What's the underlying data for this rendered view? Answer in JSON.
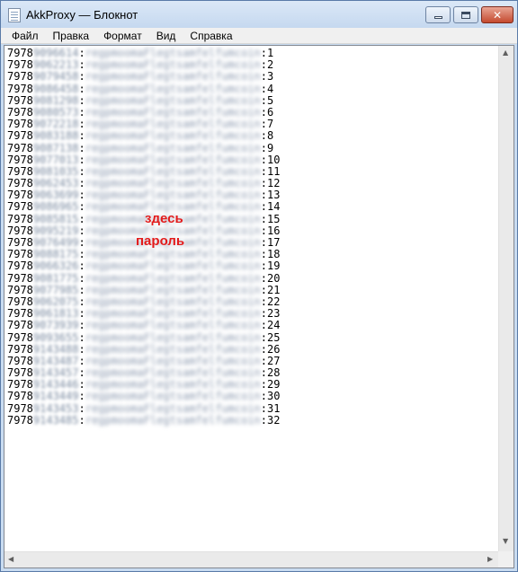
{
  "window": {
    "title": "AkkProxy — Блокнот",
    "icons": {
      "app": "notepad-icon",
      "minimize": "minimize-icon",
      "maximize": "maximize-icon",
      "close": "close-icon"
    }
  },
  "menu": [
    "Файл",
    "Правка",
    "Формат",
    "Вид",
    "Справка"
  ],
  "editor": {
    "prefix": "7978",
    "lines": [
      {
        "digits": "9096614",
        "pw": "regpmoomaFlegtsamfelfumcoin",
        "num": ":1"
      },
      {
        "digits": "9062213",
        "pw": "regpmoomaFlegtsamfelfumcoin",
        "num": ":2"
      },
      {
        "digits": "9079458",
        "pw": "regpmoomaFlegtsamfelfumcoin",
        "num": ":3"
      },
      {
        "digits": "9086458",
        "pw": "regpmoomaFlegtsamfelfumcoin",
        "num": ":4"
      },
      {
        "digits": "9081298",
        "pw": "regpmoomaFlegtsamfelfumcoin",
        "num": ":5"
      },
      {
        "digits": "9080573",
        "pw": "regpmoomaFlegtsamfelfumcoin",
        "num": ":6"
      },
      {
        "digits": "9072218",
        "pw": "regpmoomaFlegtsamfelfumcoin",
        "num": ":7"
      },
      {
        "digits": "9083188",
        "pw": "regpmoomaFlegtsamfelfumcoin",
        "num": ":8"
      },
      {
        "digits": "9087138",
        "pw": "regpmoomaFlegtsamfelfumcoin",
        "num": ":9"
      },
      {
        "digits": "9077013",
        "pw": "regpmoomaFlegtsamfelfumcoin",
        "num": ":10"
      },
      {
        "digits": "9081035",
        "pw": "regpmoomaFlegtsamfelfumcoin",
        "num": ":11"
      },
      {
        "digits": "9062453",
        "pw": "regpmoomaFlegtsamfelfumcoin",
        "num": ":12"
      },
      {
        "digits": "9063699",
        "pw": "regpmoomaFlegtsamfelfumcoin",
        "num": ":13"
      },
      {
        "digits": "9086965",
        "pw": "regpmoomaFlegtsamfelfumcoin",
        "num": ":14"
      },
      {
        "digits": "9085815",
        "pw": "regpmoomaFlegtsamfelfumcoin",
        "num": ":15"
      },
      {
        "digits": "9095219",
        "pw": "regpmoomaFlegtsamfelfumcoin",
        "num": ":16"
      },
      {
        "digits": "9076499",
        "pw": "regpmoomaFlegtsamfelfumcoin",
        "num": ":17"
      },
      {
        "digits": "9088175",
        "pw": "regpmoomaFlegtsamfelfumcoin",
        "num": ":18"
      },
      {
        "digits": "9066326",
        "pw": "regpmoomaFlegtsamfelfumcoin",
        "num": ":19"
      },
      {
        "digits": "9081775",
        "pw": "regpmoomaFlegtsamfelfumcoin",
        "num": ":20"
      },
      {
        "digits": "9077985",
        "pw": "regpmoomaFlegtsamfelfumcoin",
        "num": ":21"
      },
      {
        "digits": "9062075",
        "pw": "regpmoomaFlegtsamfelfumcoin",
        "num": ":22"
      },
      {
        "digits": "9061813",
        "pw": "regpmoomaFlegtsamfelfumcoin",
        "num": ":23"
      },
      {
        "digits": "9073939",
        "pw": "regpmoomaFlegtsamfelfumcoin",
        "num": ":24"
      },
      {
        "digits": "9093655",
        "pw": "regpmoomaFlegtsamfelfumcoin",
        "num": ":25"
      },
      {
        "digits": "9143488",
        "pw": "regpmoomaFlegtsamfelfumcoin",
        "num": ":26"
      },
      {
        "digits": "9143487",
        "pw": "regpmoomaFlegtsamfelfumcoin",
        "num": ":27"
      },
      {
        "digits": "9143457",
        "pw": "regpmoomaFlegtsamfelfumcoin",
        "num": ":28"
      },
      {
        "digits": "9143446",
        "pw": "regpmoomaFlegtsamfelfumcoin",
        "num": ":29"
      },
      {
        "digits": "9143449",
        "pw": "regpmoomaFlegtsamfelfumcoin",
        "num": ":30"
      },
      {
        "digits": "9143453",
        "pw": "regpmoomaFlegtsamfelfumcoin",
        "num": ":31"
      },
      {
        "digits": "9143485",
        "pw": "regpmoomaFlegtsamfelfumcoin",
        "num": ":32"
      }
    ],
    "annotation": [
      "здесь",
      "пароль"
    ],
    "annotation_color": "#e31b1b"
  },
  "scrollbar_icons": {
    "up": "scroll-up-icon",
    "down": "scroll-down-icon",
    "left": "scroll-left-icon",
    "right": "scroll-right-icon"
  }
}
